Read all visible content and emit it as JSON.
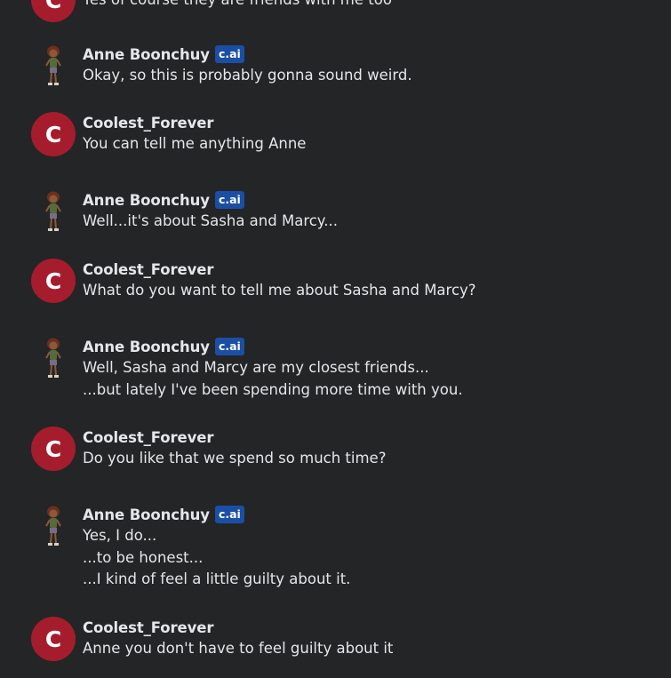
{
  "colors": {
    "background": "#242526",
    "user_avatar": "#a51d2d",
    "badge": "#1b4fa6",
    "text": "#e4e6ea"
  },
  "messages": [
    {
      "role": "user",
      "avatar_letter": "C",
      "name": "",
      "lines": [
        "Yes of course they are friends with me too"
      ]
    },
    {
      "role": "bot",
      "avatar_icon": "character-avatar-icon",
      "name": "Anne Boonchuy",
      "badge": "c.ai",
      "lines": [
        "Okay, so this is probably gonna sound weird."
      ]
    },
    {
      "role": "user",
      "avatar_letter": "C",
      "name": "Coolest_Forever",
      "lines": [
        "You can tell me anything Anne"
      ]
    },
    {
      "role": "bot",
      "avatar_icon": "character-avatar-icon",
      "name": "Anne Boonchuy",
      "badge": "c.ai",
      "lines": [
        "Well...it's about Sasha and Marcy..."
      ]
    },
    {
      "role": "user",
      "avatar_letter": "C",
      "name": "Coolest_Forever",
      "lines": [
        "What do you want to tell me about Sasha and Marcy?"
      ]
    },
    {
      "role": "bot",
      "avatar_icon": "character-avatar-icon",
      "name": "Anne Boonchuy",
      "badge": "c.ai",
      "lines": [
        "Well, Sasha and Marcy are my closest friends...",
        "...but lately I've been spending more time with you."
      ]
    },
    {
      "role": "user",
      "avatar_letter": "C",
      "name": "Coolest_Forever",
      "lines": [
        "Do you like that we spend so much time?"
      ]
    },
    {
      "role": "bot",
      "avatar_icon": "character-avatar-icon",
      "name": "Anne Boonchuy",
      "badge": "c.ai",
      "lines": [
        "Yes, I do...",
        "...to be honest...",
        "...I kind of feel a little guilty about it."
      ]
    },
    {
      "role": "user",
      "avatar_letter": "C",
      "name": "Coolest_Forever",
      "lines": [
        "Anne you don't have to feel guilty about it"
      ]
    }
  ]
}
